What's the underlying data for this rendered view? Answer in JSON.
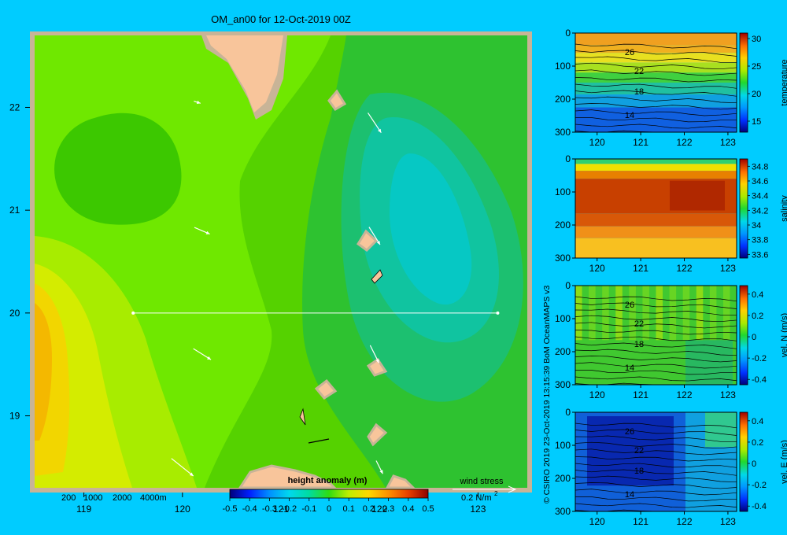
{
  "chart_data": [
    {
      "type": "heatmap",
      "title": "OM_an00 for 12-Oct-2019 00Z",
      "subtitle": "",
      "xlabel": "",
      "ylabel": "",
      "xlim": [
        118.5,
        123.5
      ],
      "ylim": [
        18.3,
        22.7
      ],
      "x_ticks": [
        "119",
        "120",
        "121",
        "122",
        "123"
      ],
      "y_ticks": [
        "19",
        "20",
        "21",
        "22"
      ],
      "colorbar": {
        "label": "height anomaly (m)",
        "range": [
          -0.5,
          0.5
        ],
        "ticks": [
          "-0.5",
          "-0.4",
          "-0.3",
          "-0.2",
          "-0.1",
          "0",
          "0.1",
          "0.2",
          "0.3",
          "0.4",
          "0.5"
        ]
      },
      "depth_legend": [
        "200",
        "1000",
        "2000",
        "4000m"
      ],
      "wind_legend": {
        "label": "wind stress",
        "value": "0.2 N/m",
        "superscript": "2"
      },
      "transect": {
        "lat": 20,
        "lon_start": 119.5,
        "lon_end": 123.2
      },
      "wind_vectors": [
        {
          "lon": 120.15,
          "lat": 22.05,
          "u": 0.03,
          "v": -0.01
        },
        {
          "lon": 121.95,
          "lat": 21.85,
          "u": 0.06,
          "v": -0.09
        },
        {
          "lon": 120.2,
          "lat": 20.8,
          "u": 0.07,
          "v": -0.03
        },
        {
          "lon": 121.95,
          "lat": 20.75,
          "u": 0.05,
          "v": -0.08
        },
        {
          "lon": 120.2,
          "lat": 19.6,
          "u": 0.08,
          "v": -0.05
        },
        {
          "lon": 121.95,
          "lat": 19.6,
          "u": 0.04,
          "v": -0.08
        },
        {
          "lon": 120.0,
          "lat": 18.5,
          "u": 0.1,
          "v": -0.08
        },
        {
          "lon": 122.0,
          "lat": 18.5,
          "u": 0.03,
          "v": -0.06
        }
      ],
      "colors": {
        "land": "#f8c59b",
        "shelf": "#c8b497",
        "frame": "#c8b497"
      }
    },
    {
      "type": "heatmap",
      "variable": "temperature",
      "colorbar_label": "temperature",
      "colorbar_ticks": [
        "15",
        "20",
        "25",
        "30"
      ],
      "colorbar_range": [
        13,
        31
      ],
      "contour_labels": [
        "26",
        "22",
        "18",
        "14"
      ],
      "x_ticks": [
        "120",
        "121",
        "122",
        "123"
      ],
      "y_ticks": [
        "0",
        "100",
        "200",
        "300"
      ],
      "xlim": [
        119.5,
        123.2
      ],
      "ylim": [
        300,
        0
      ]
    },
    {
      "type": "heatmap",
      "variable": "salinity",
      "colorbar_label": "salinity",
      "colorbar_ticks": [
        "33.6",
        "33.8",
        "34",
        "34.2",
        "34.4",
        "34.6",
        "34.8"
      ],
      "colorbar_range": [
        33.55,
        34.9
      ],
      "contour_labels": [],
      "x_ticks": [
        "120",
        "121",
        "122",
        "123"
      ],
      "y_ticks": [
        "0",
        "100",
        "200",
        "300"
      ],
      "xlim": [
        119.5,
        123.2
      ],
      "ylim": [
        300,
        0
      ]
    },
    {
      "type": "heatmap",
      "variable": "vel. N (m/s)",
      "colorbar_label": "vel. N  (m/s)",
      "colorbar_ticks": [
        "-0.4",
        "-0.2",
        "0",
        "0.2",
        "0.4"
      ],
      "colorbar_range": [
        -0.45,
        0.48
      ],
      "contour_labels": [
        "26",
        "22",
        "18",
        "14"
      ],
      "x_ticks": [
        "120",
        "121",
        "122",
        "123"
      ],
      "y_ticks": [
        "0",
        "100",
        "200",
        "300"
      ],
      "xlim": [
        119.5,
        123.2
      ],
      "ylim": [
        300,
        0
      ]
    },
    {
      "type": "heatmap",
      "variable": "vel. E (m/s)",
      "colorbar_label": "vel. E  (m/s)",
      "colorbar_ticks": [
        "-0.4",
        "-0.2",
        "0",
        "0.2",
        "0.4"
      ],
      "colorbar_range": [
        -0.45,
        0.48
      ],
      "contour_labels": [
        "26",
        "22",
        "18",
        "14"
      ],
      "x_ticks": [
        "120",
        "121",
        "122",
        "123"
      ],
      "y_ticks": [
        "0",
        "100",
        "200",
        "300"
      ],
      "xlim": [
        119.5,
        123.2
      ],
      "ylim": [
        300,
        0
      ]
    }
  ],
  "credit": "© CSIRO 2019   23-Oct-2019 13:15:39 BoM OceanMAPS v3"
}
